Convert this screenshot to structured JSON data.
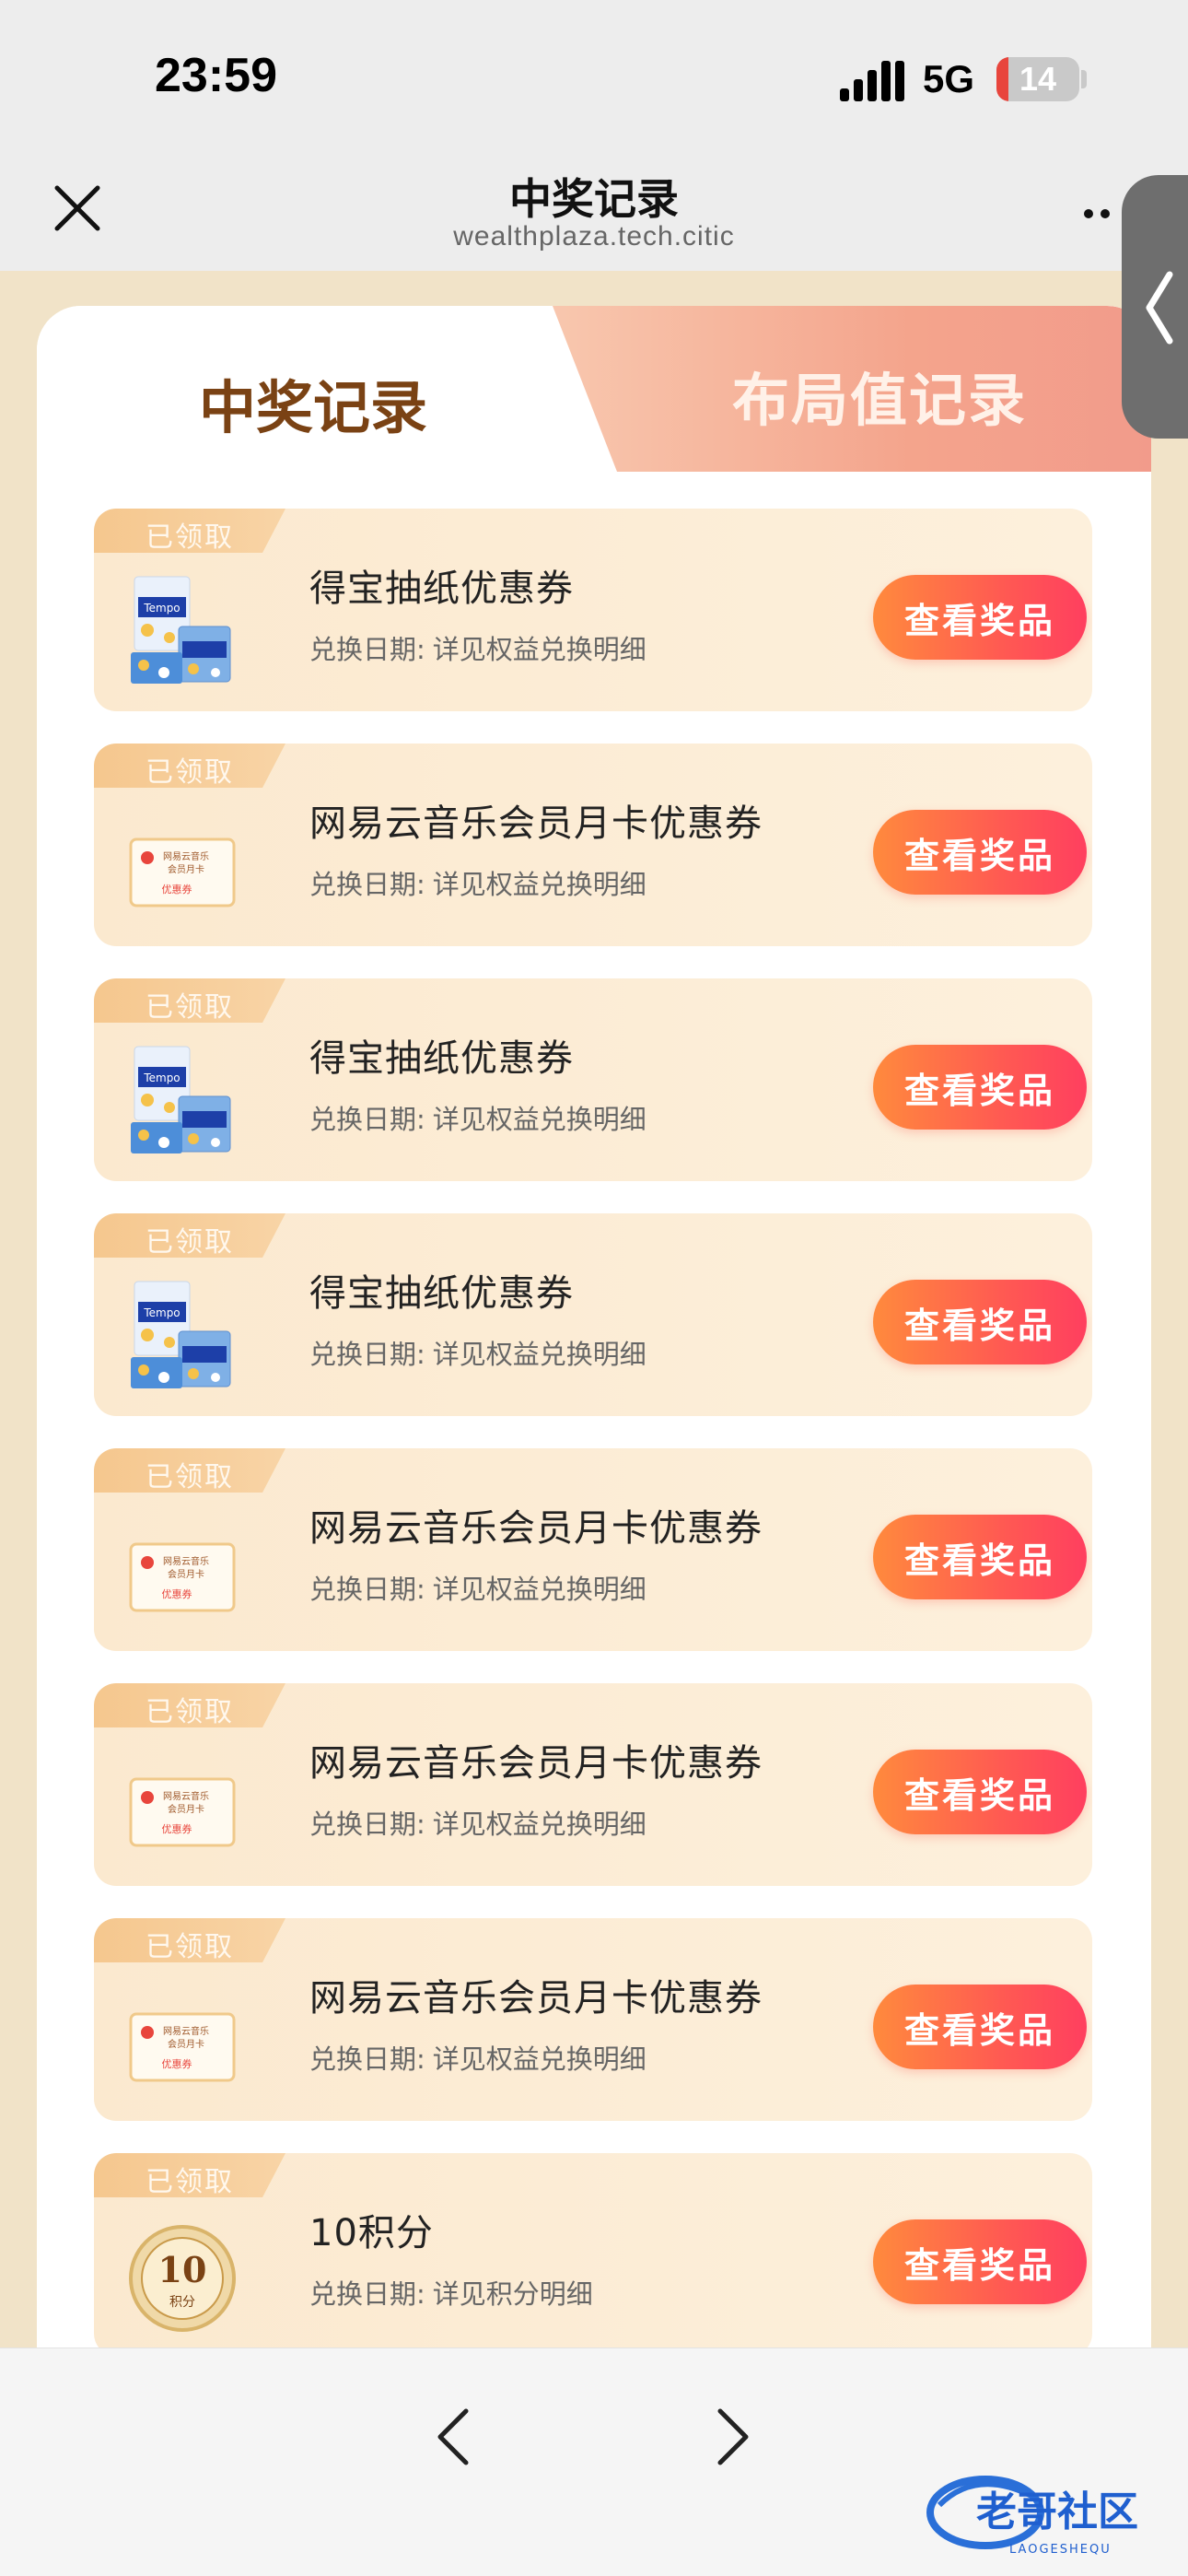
{
  "status": {
    "time": "23:59",
    "network": "5G",
    "battery": "14"
  },
  "nav": {
    "title": "中奖记录",
    "subtitle": "wealthplaza.tech.citic"
  },
  "tabs": {
    "active": "中奖记录",
    "inactive": "布局值记录"
  },
  "records": [
    {
      "badge": "已领取",
      "title": "得宝抽纸优惠券",
      "date_label": "兑换日期:",
      "date_value": "详见权益兑换明细",
      "button": "查看奖品",
      "thumb": "tissue-icon"
    },
    {
      "badge": "已领取",
      "title": "网易云音乐会员月卡优惠券",
      "date_label": "兑换日期:",
      "date_value": "详见权益兑换明细",
      "button": "查看奖品",
      "thumb": "coupon-icon"
    },
    {
      "badge": "已领取",
      "title": "得宝抽纸优惠券",
      "date_label": "兑换日期:",
      "date_value": "详见权益兑换明细",
      "button": "查看奖品",
      "thumb": "tissue-icon"
    },
    {
      "badge": "已领取",
      "title": "得宝抽纸优惠券",
      "date_label": "兑换日期:",
      "date_value": "详见权益兑换明细",
      "button": "查看奖品",
      "thumb": "tissue-icon"
    },
    {
      "badge": "已领取",
      "title": "网易云音乐会员月卡优惠券",
      "date_label": "兑换日期:",
      "date_value": "详见权益兑换明细",
      "button": "查看奖品",
      "thumb": "coupon-icon"
    },
    {
      "badge": "已领取",
      "title": "网易云音乐会员月卡优惠券",
      "date_label": "兑换日期:",
      "date_value": "详见权益兑换明细",
      "button": "查看奖品",
      "thumb": "coupon-icon"
    },
    {
      "badge": "已领取",
      "title": "网易云音乐会员月卡优惠券",
      "date_label": "兑换日期:",
      "date_value": "详见权益兑换明细",
      "button": "查看奖品",
      "thumb": "coupon-icon"
    },
    {
      "badge": "已领取",
      "title": "10积分",
      "date_label": "兑换日期:",
      "date_value": "详见积分明细",
      "button": "查看奖品",
      "thumb": "points-medal-icon"
    }
  ],
  "coupon_thumb": {
    "line1": "网易云音乐",
    "line2": "会员月卡",
    "line3": "优惠券"
  },
  "medal": {
    "value": "10",
    "unit": "积分"
  },
  "watermark": {
    "text": "老哥社区",
    "subtext": "LAOGESHEQU"
  },
  "colors": {
    "accent": "#ff5a52",
    "tab_active_text": "#7a4214",
    "badge": "#f5c78e"
  }
}
